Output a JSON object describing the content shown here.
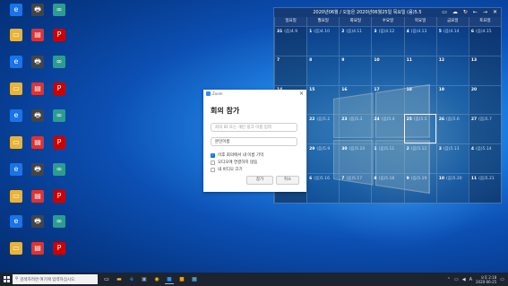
{
  "desktop_icons": [
    {
      "name": "edge-icon",
      "label": "Microsoft Edge",
      "color": "#1a73e8",
      "glyph": "e"
    },
    {
      "name": "printer-icon",
      "label": "프린터",
      "color": "#444",
      "glyph": "🖶"
    },
    {
      "name": "file-icon",
      "label": "문서",
      "color": "#2a9d8f",
      "glyph": "∞"
    },
    {
      "name": "folder-icon",
      "label": "",
      "color": "#e8b33a",
      "glyph": "▭"
    },
    {
      "name": "app-icon",
      "label": "",
      "color": "#d33",
      "glyph": "▤"
    },
    {
      "name": "pdf-icon",
      "label": "",
      "color": "#c00",
      "glyph": "P"
    }
  ],
  "calendar": {
    "title": "2020년06월 / 오늘은 2020년06월25일 목요일 (음)5.5",
    "controls": [
      "▭",
      "☁",
      "↻",
      "←",
      "→",
      "✕"
    ],
    "days": [
      "일요일",
      "월요일",
      "화요일",
      "수요일",
      "목요일",
      "금요일",
      "토요일"
    ],
    "rows": [
      [
        {
          "d": "31",
          "l": "(음)4.9"
        },
        {
          "d": "1",
          "l": "(음)4.10"
        },
        {
          "d": "2",
          "l": "(음)4.11"
        },
        {
          "d": "3",
          "l": "(음)4.12"
        },
        {
          "d": "4",
          "l": "(음)4.13"
        },
        {
          "d": "5",
          "l": "(음)4.14"
        },
        {
          "d": "6",
          "l": "(음)4.15"
        }
      ],
      [
        {
          "d": "7",
          "l": ""
        },
        {
          "d": "8",
          "l": ""
        },
        {
          "d": "9",
          "l": ""
        },
        {
          "d": "10",
          "l": ""
        },
        {
          "d": "11",
          "l": ""
        },
        {
          "d": "12",
          "l": ""
        },
        {
          "d": "13",
          "l": ""
        }
      ],
      [
        {
          "d": "14",
          "l": ""
        },
        {
          "d": "15",
          "l": ""
        },
        {
          "d": "16",
          "l": ""
        },
        {
          "d": "17",
          "l": ""
        },
        {
          "d": "18",
          "l": ""
        },
        {
          "d": "19",
          "l": ""
        },
        {
          "d": "20",
          "l": ""
        }
      ],
      [
        {
          "d": "21",
          "l": "(음)5.1"
        },
        {
          "d": "22",
          "l": "(음)5.2"
        },
        {
          "d": "23",
          "l": "(음)5.3"
        },
        {
          "d": "24",
          "l": "(음)5.4"
        },
        {
          "d": "25",
          "l": "(음)5.5"
        },
        {
          "d": "26",
          "l": "(음)5.6"
        },
        {
          "d": "27",
          "l": "(음)5.7"
        }
      ],
      [
        {
          "d": "28",
          "l": "(음)5.8"
        },
        {
          "d": "29",
          "l": "(음)5.9"
        },
        {
          "d": "30",
          "l": "(음)5.10"
        },
        {
          "d": "1",
          "l": "(음)5.11"
        },
        {
          "d": "2",
          "l": "(음)5.12"
        },
        {
          "d": "3",
          "l": "(음)5.13"
        },
        {
          "d": "4",
          "l": "(음)5.14"
        }
      ],
      [
        {
          "d": "5",
          "l": "(음)5.15"
        },
        {
          "d": "6",
          "l": "(음)5.16"
        },
        {
          "d": "7",
          "l": "(음)5.17"
        },
        {
          "d": "8",
          "l": "(음)5.18"
        },
        {
          "d": "9",
          "l": "(음)5.19"
        },
        {
          "d": "10",
          "l": "(음)5.20"
        },
        {
          "d": "11",
          "l": "(음)5.21"
        }
      ]
    ]
  },
  "dialog": {
    "app_name": "Zoom",
    "title": "회의 참가",
    "meeting_placeholder": "회의 ID 또는 개인 링크 이름 입력",
    "name_value": "본인이름",
    "checks": [
      {
        "label": "이후 회의에서 내 이름 기억",
        "checked": true
      },
      {
        "label": "오디오에 연결하지 않음",
        "checked": false
      },
      {
        "label": "내 비디오 끄기",
        "checked": false
      }
    ],
    "join_label": "참가",
    "cancel_label": "취소"
  },
  "taskbar": {
    "search_placeholder": "검색하려면 여기에 입력하십시오.",
    "time": "오후 2:18",
    "date": "2020-06-25",
    "tray_lang": "A"
  }
}
